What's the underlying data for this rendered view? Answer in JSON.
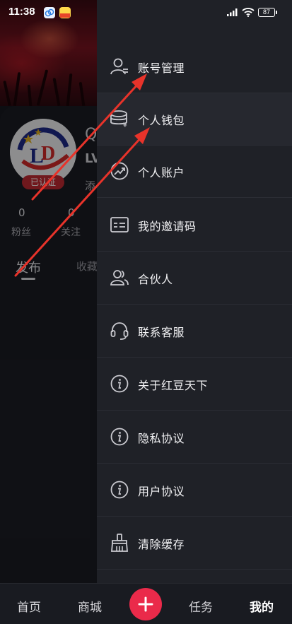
{
  "status_bar": {
    "time": "11:38",
    "battery": "87"
  },
  "profile": {
    "name_partial": "Q",
    "level_partial": "LV",
    "add_partial": "添",
    "verified": "已认证",
    "stats": [
      {
        "value": "0",
        "label": "粉丝"
      },
      {
        "value": "0",
        "label": "关注"
      }
    ],
    "tabs": {
      "publish": "发布",
      "collect": "收藏"
    }
  },
  "drawer": {
    "items": [
      {
        "label": "账号管理",
        "icon": "user-icon"
      },
      {
        "label": "个人钱包",
        "icon": "wallet-coins-icon"
      },
      {
        "label": "个人账户",
        "icon": "account-trend-icon"
      },
      {
        "label": "我的邀请码",
        "icon": "invite-card-icon"
      },
      {
        "label": "合伙人",
        "icon": "partners-icon"
      },
      {
        "label": "联系客服",
        "icon": "headset-icon"
      },
      {
        "label": "关于红豆天下",
        "icon": "info-icon"
      },
      {
        "label": "隐私协议",
        "icon": "info-icon"
      },
      {
        "label": "用户协议",
        "icon": "info-icon"
      },
      {
        "label": "清除缓存",
        "icon": "broom-icon"
      }
    ]
  },
  "bottom_nav": {
    "home": "首页",
    "mall": "商城",
    "tasks": "任务",
    "mine": "我的"
  },
  "colors": {
    "accent": "#ea2a4a",
    "annotation_arrow": "#e8332a",
    "drawer_bg": "#1f2127"
  }
}
